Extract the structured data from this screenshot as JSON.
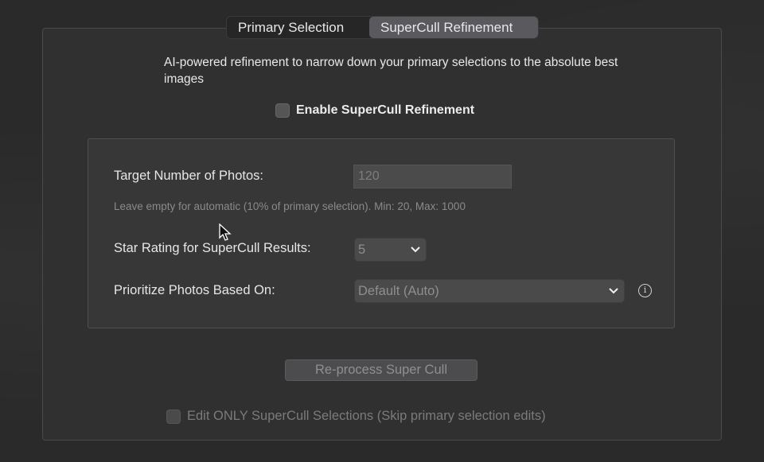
{
  "tabs": [
    {
      "label": "Primary Selection",
      "active": false
    },
    {
      "label": "SuperCull Refinement",
      "active": true
    }
  ],
  "description": "AI-powered refinement to narrow down your primary selections to the absolute best images",
  "enable": {
    "label": "Enable SuperCull Refinement",
    "checked": false
  },
  "target": {
    "label": "Target Number of Photos:",
    "value": "120",
    "hint": "Leave empty for automatic (10% of primary selection). Min: 20, Max: 1000"
  },
  "star_rating": {
    "label": "Star Rating for SuperCull Results:",
    "value": "5"
  },
  "prioritize": {
    "label": "Prioritize Photos Based On:",
    "value": "Default (Auto)"
  },
  "reprocess_button": "Re-process Super Cull",
  "edit_only": {
    "label": "Edit ONLY SuperCull Selections (Skip primary selection edits)",
    "checked": false
  },
  "icons": {
    "info": "info-icon",
    "chevron": "chevron-down-icon",
    "cursor": "mouse-cursor-icon"
  }
}
